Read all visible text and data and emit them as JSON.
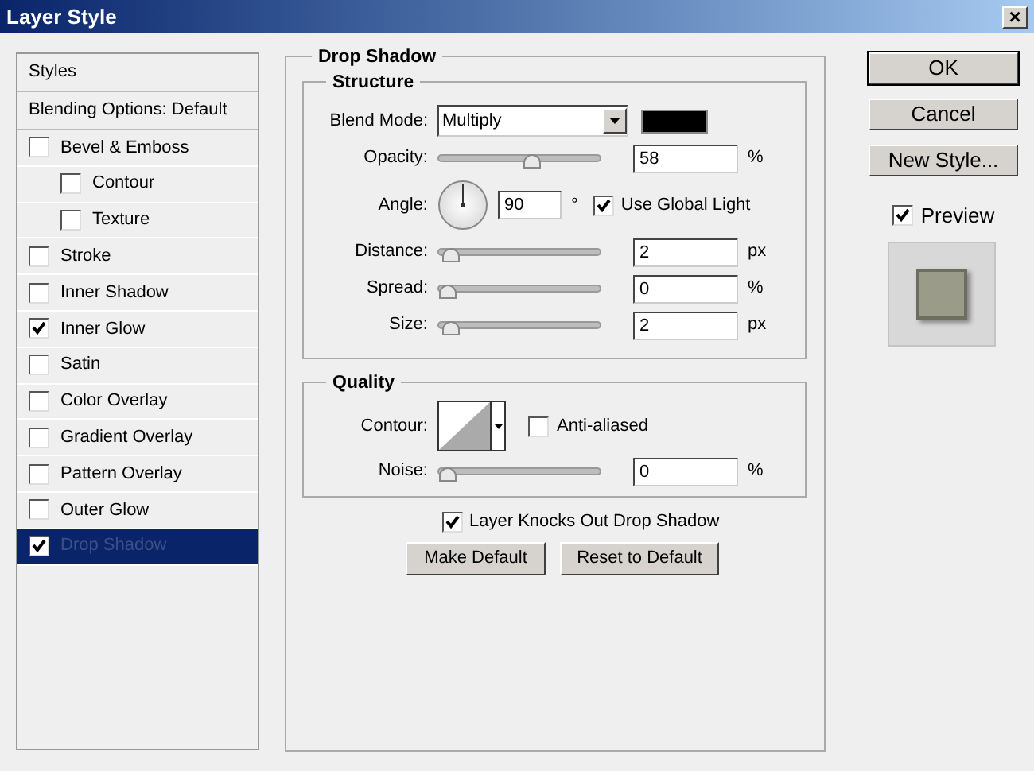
{
  "window": {
    "title": "Layer Style",
    "close": "×"
  },
  "style_list": [
    {
      "kind": "header",
      "label": "Styles",
      "selected": false
    },
    {
      "kind": "header",
      "label": "Blending Options: Default",
      "selected": false
    },
    {
      "kind": "check",
      "label": "Bevel & Emboss",
      "checked": false,
      "selected": false,
      "children": [
        {
          "kind": "check",
          "label": "Contour",
          "checked": false,
          "selected": false
        },
        {
          "kind": "check",
          "label": "Texture",
          "checked": false,
          "selected": false
        }
      ]
    },
    {
      "kind": "check",
      "label": "Stroke",
      "checked": false,
      "selected": false
    },
    {
      "kind": "check",
      "label": "Inner Shadow",
      "checked": false,
      "selected": false
    },
    {
      "kind": "check",
      "label": "Inner Glow",
      "checked": true,
      "selected": false
    },
    {
      "kind": "check",
      "label": "Satin",
      "checked": false,
      "selected": false
    },
    {
      "kind": "check",
      "label": "Color Overlay",
      "checked": false,
      "selected": false
    },
    {
      "kind": "check",
      "label": "Gradient Overlay",
      "checked": false,
      "selected": false
    },
    {
      "kind": "check",
      "label": "Pattern Overlay",
      "checked": false,
      "selected": false
    },
    {
      "kind": "check",
      "label": "Outer Glow",
      "checked": false,
      "selected": false
    },
    {
      "kind": "check",
      "label": "Drop Shadow",
      "checked": true,
      "selected": true
    }
  ],
  "panel": {
    "title": "Drop Shadow",
    "structure": {
      "title": "Structure",
      "blend_mode": {
        "label": "Blend Mode:",
        "value": "Multiply",
        "color": "#000000"
      },
      "opacity": {
        "label": "Opacity:",
        "level": 0.58,
        "value": "58",
        "unit": "%"
      },
      "angle": {
        "label": "Angle:",
        "value": "90",
        "unit": "°",
        "global_light": {
          "label": "Use Global Light",
          "checked": true
        }
      },
      "sliders": [
        {
          "label": "Distance:",
          "level": 0.02,
          "value": "2",
          "unit": "px"
        },
        {
          "label": "Spread:",
          "level": 0,
          "value": "0",
          "unit": "%"
        },
        {
          "label": "Size:",
          "level": 0.02,
          "value": "2",
          "unit": "px"
        }
      ]
    },
    "quality": {
      "title": "Quality",
      "contour": {
        "label": "Contour:"
      },
      "anti_aliased": {
        "label": "Anti-aliased",
        "checked": false
      },
      "noise": {
        "label": "Noise:",
        "level": 0,
        "value": "0",
        "unit": "%"
      }
    },
    "knockout": {
      "label": "Layer Knocks Out Drop Shadow",
      "checked": true
    },
    "buttons": [
      "Make Default",
      "Reset to Default"
    ]
  },
  "actions": [
    "OK",
    "Cancel",
    "New Style..."
  ],
  "preview": {
    "label": "Preview",
    "checked": true
  }
}
